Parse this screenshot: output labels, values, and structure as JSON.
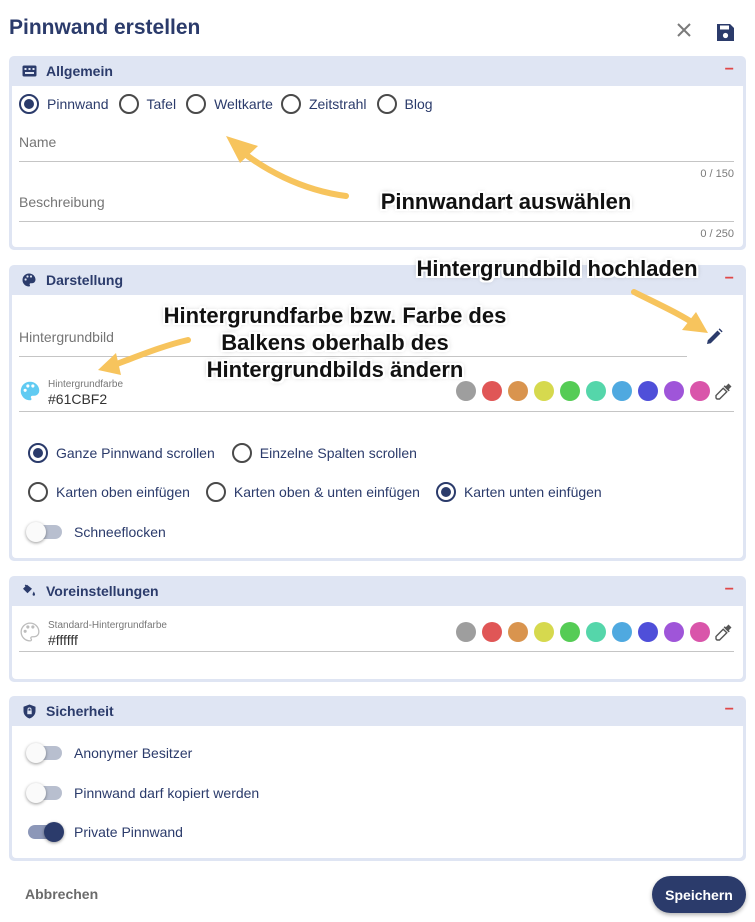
{
  "dialog": {
    "title": "Pinnwand erstellen",
    "close_icon": "close-icon",
    "save_icon": "floppy-disk-icon"
  },
  "general": {
    "heading": "Allgemein",
    "collapse": "−",
    "types": [
      {
        "label": "Pinnwand",
        "selected": true
      },
      {
        "label": "Tafel",
        "selected": false
      },
      {
        "label": "Weltkarte",
        "selected": false
      },
      {
        "label": "Zeitstrahl",
        "selected": false
      },
      {
        "label": "Blog",
        "selected": false
      }
    ],
    "name_label": "Name",
    "name_counter": "0 / 150",
    "desc_label": "Beschreibung",
    "desc_counter": "0 / 250"
  },
  "display": {
    "heading": "Darstellung",
    "collapse": "−",
    "bg_image_label": "Hintergrundbild",
    "bg_color_label": "Hintergrundfarbe",
    "bg_color_value": "#61CBF2",
    "scroll_options": [
      {
        "label": "Ganze Pinnwand scrollen",
        "selected": true
      },
      {
        "label": "Einzelne Spalten scrollen",
        "selected": false
      }
    ],
    "card_options": [
      {
        "label": "Karten oben einfügen",
        "selected": false
      },
      {
        "label": "Karten oben & unten einfügen",
        "selected": false
      },
      {
        "label": "Karten unten einfügen",
        "selected": true
      }
    ],
    "snow_label": "Schneeflocken",
    "snow_on": false
  },
  "palette": [
    "#9e9e9e",
    "#e05656",
    "#d9944e",
    "#d6d94e",
    "#55cc55",
    "#55d6aa",
    "#4fa9e0",
    "#4f4fd9",
    "#9f55d9",
    "#d955aa"
  ],
  "defaults": {
    "heading": "Voreinstellungen",
    "collapse": "−",
    "std_color_label": "Standard-Hintergrundfarbe",
    "std_color_value": "#ffffff"
  },
  "security": {
    "heading": "Sicherheit",
    "collapse": "−",
    "toggles": [
      {
        "label": "Anonymer Besitzer",
        "on": false
      },
      {
        "label": "Pinnwand darf kopiert werden",
        "on": false
      },
      {
        "label": "Private Pinnwand",
        "on": true
      }
    ]
  },
  "footer": {
    "cancel": "Abbrechen",
    "save": "Speichern"
  },
  "annotations": {
    "type": "Pinnwandart auswählen",
    "upload": "Hintergrundbild hochladen",
    "color_line1": "Hintergrundfarbe bzw. Farbe des",
    "color_line2": "Balkens oberhalb des",
    "color_line3": "Hintergrundbilds ändern"
  }
}
